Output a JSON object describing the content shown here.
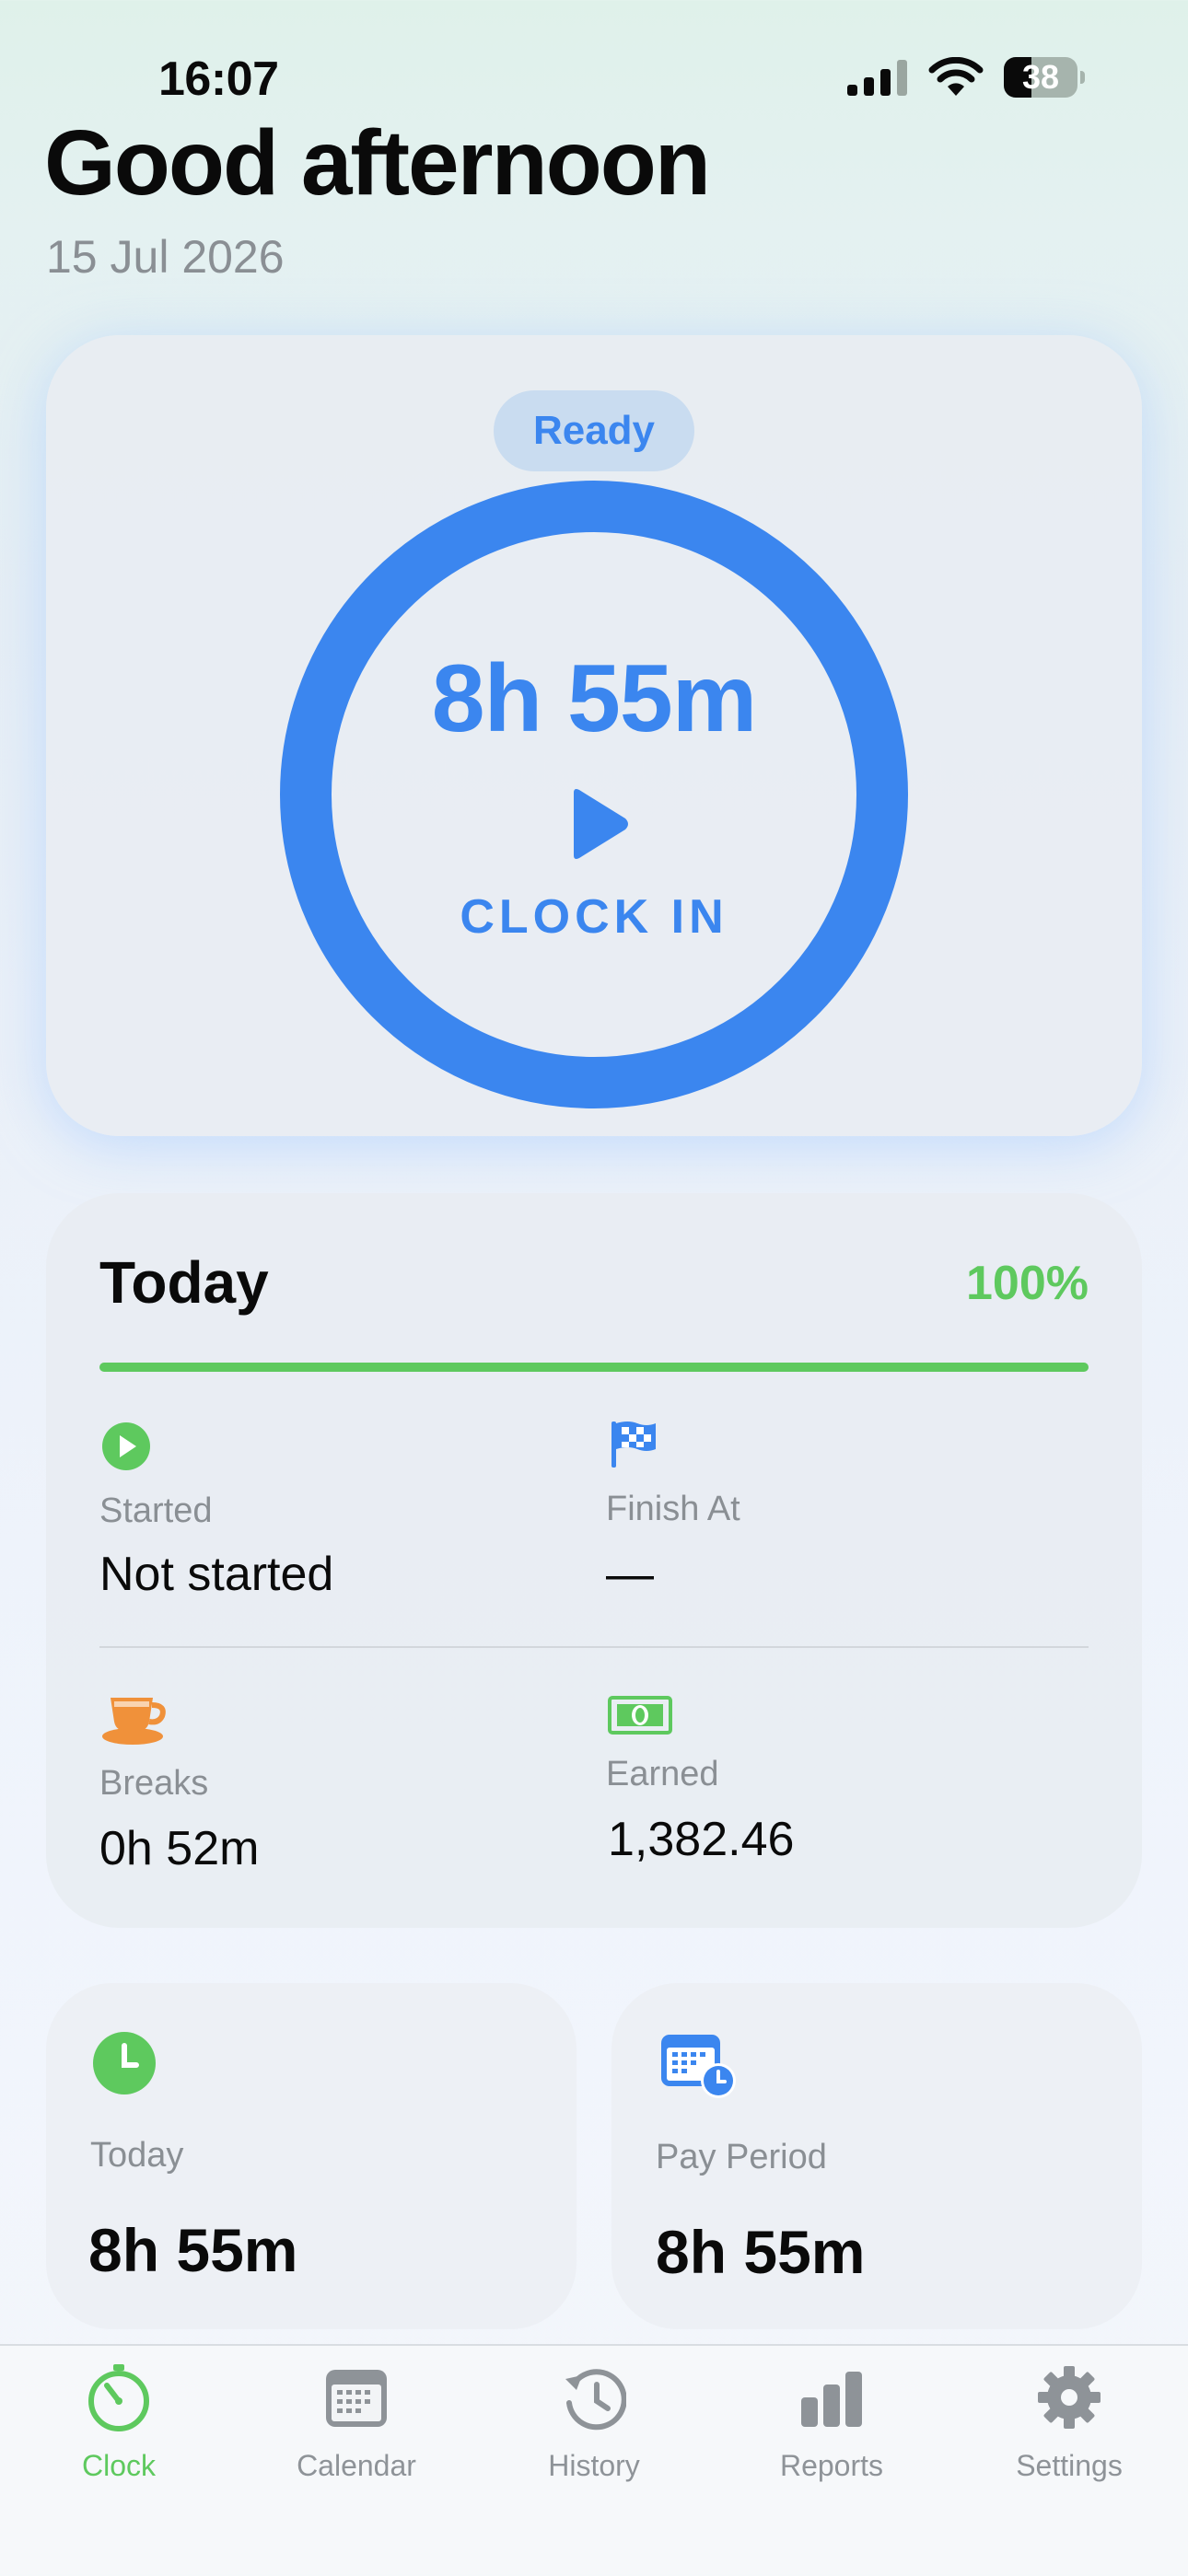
{
  "status_bar": {
    "time": "16:07",
    "battery_percent": "38",
    "icons": [
      "cellular-signal-icon",
      "wifi-icon",
      "battery-icon"
    ]
  },
  "header": {
    "greeting": "Good afternoon",
    "date": "15 Jul 2026"
  },
  "clock_card": {
    "status": "Ready",
    "elapsed": "8h 55m",
    "action_label": "CLOCK IN",
    "action_icon": "play-icon",
    "ring_color": "#3b86ef"
  },
  "today_card": {
    "title": "Today",
    "progress_percent_label": "100%",
    "progress_fraction": 1.0,
    "progress_color": "#5ec95e",
    "stats": [
      {
        "icon": "play-circle-icon",
        "label": "Started",
        "value": "Not started"
      },
      {
        "icon": "checkered-flag-icon",
        "label": "Finish At",
        "value": "—"
      },
      {
        "icon": "coffee-cup-icon",
        "label": "Breaks",
        "value": "0h 52m"
      },
      {
        "icon": "banknote-icon",
        "label": "Earned",
        "value": "1,382.46"
      }
    ]
  },
  "summary_cards": [
    {
      "icon": "clock-icon",
      "label": "Today",
      "value": "8h 55m"
    },
    {
      "icon": "calendar-clock-icon",
      "label": "Pay Period",
      "value": "8h 55m"
    }
  ],
  "tab_bar": {
    "active": "Clock",
    "tabs": [
      {
        "label": "Clock",
        "icon": "timer-icon"
      },
      {
        "label": "Calendar",
        "icon": "calendar-icon"
      },
      {
        "label": "History",
        "icon": "history-icon"
      },
      {
        "label": "Reports",
        "icon": "bar-chart-icon"
      },
      {
        "label": "Settings",
        "icon": "gear-icon"
      }
    ]
  },
  "colors": {
    "accent_blue": "#3b86ef",
    "accent_green": "#5ec95e",
    "accent_orange": "#f0913a",
    "muted_text": "#8a8f94"
  }
}
